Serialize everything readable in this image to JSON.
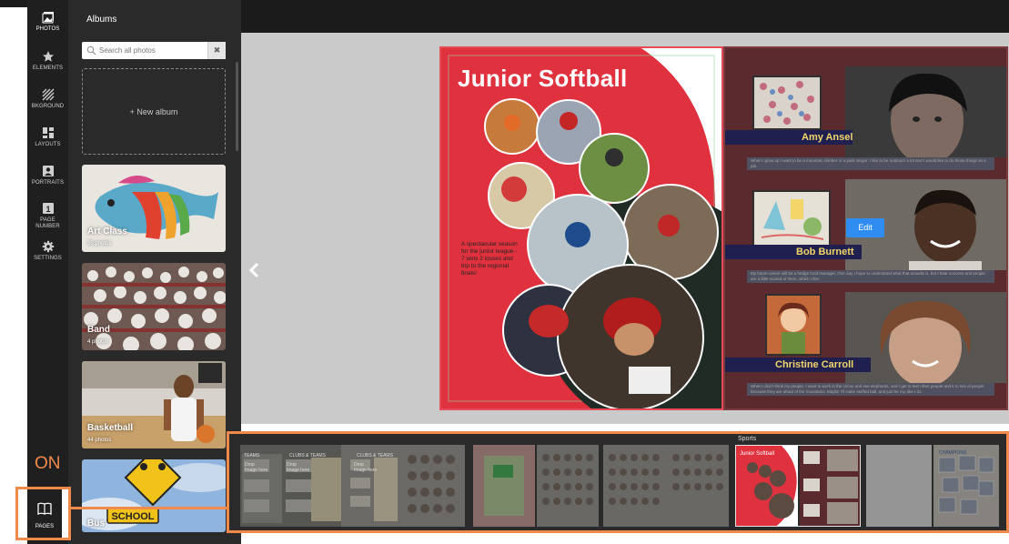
{
  "rail": {
    "items": [
      {
        "label": "PHOTOS",
        "icon": "photos-icon"
      },
      {
        "label": "ELEMENTS",
        "icon": "star-icon"
      },
      {
        "label": "BKGROUND",
        "icon": "stripes-icon"
      },
      {
        "label": "LAYOUTS",
        "icon": "layouts-icon"
      },
      {
        "label": "PORTRAITS",
        "icon": "portrait-icon"
      },
      {
        "label": "PAGE NUMBER",
        "icon": "page-number-icon",
        "badge": "1"
      },
      {
        "label": "SETTINGS",
        "icon": "gear-icon"
      }
    ],
    "pages_label": "PAGES"
  },
  "albums": {
    "title": "Albums",
    "search_placeholder": "Search all photos",
    "search_clear": "✖",
    "new_album": "+ New album",
    "cards": [
      {
        "name": "Art Class",
        "count": "35 photos"
      },
      {
        "name": "Band",
        "count": "4 photos"
      },
      {
        "name": "Basketball",
        "count": "44 photos"
      },
      {
        "name": "Bus",
        "count": ""
      }
    ]
  },
  "spread": {
    "title": "Junior Softball",
    "caption": "A spectacular season for the junior league - 7 wins 2 losses and trip to the regional finals!",
    "edit_label": "Edit",
    "profiles": [
      {
        "name": "Amy Ansel",
        "bio": "When I grow up I want to be a mountain climber or a park ranger. I like to be outdoors a lot and I would like to do those things as a job."
      },
      {
        "name": "Bob Burnett",
        "bio": "My future career will be a hedge fund manager. One day I hope to understand what that actually is, but I hear success and people are a little scared of them, which I like."
      },
      {
        "name": "Christine Carroll",
        "bio": "When I don't think my people, I want to work in the circus and see elephants, and I get to feel other people and it to lots of people because they are afraid of the mountains. Maybe I'll make stuffed ball, and just be my, like I do."
      }
    ]
  },
  "strip": {
    "label": "Sports",
    "spread_labels": [
      "TEAMS",
      "CLUBS & TEAMS",
      "CLUBS & TEAMS",
      "Junior Softball",
      "CHAMPIONS"
    ],
    "drop_text": "Drop Image here"
  },
  "annotation": {
    "on_label": "ON"
  },
  "colors": {
    "accent": "#f08a4b",
    "softball_red": "#e0323e",
    "right_page": "#5a2a2e",
    "name_gold": "#f2d66a",
    "edit_blue": "#2f8cf0"
  }
}
